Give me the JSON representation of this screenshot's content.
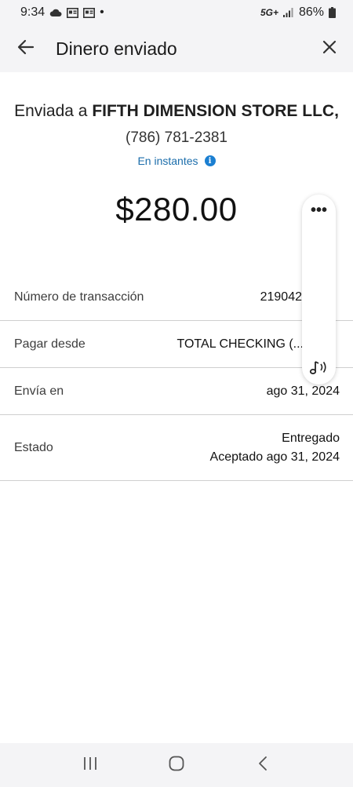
{
  "status_bar": {
    "time": "9:34",
    "dot": "•",
    "network": "5G+",
    "battery": "86%"
  },
  "header": {
    "title": "Dinero enviado",
    "back_icon": "arrow-left-icon",
    "close_icon": "close-icon"
  },
  "recipient": {
    "prefix": "Enviada a ",
    "name": "FIFTH DIMENSION STORE LLC,",
    "phone": "(786) 781-2381",
    "speed": "En instantes"
  },
  "amount": "$280.00",
  "details": {
    "transaction": {
      "label": "Número de transacción",
      "value": "219042"
    },
    "pay_from": {
      "label": "Pagar desde",
      "value": "TOTAL CHECKING (..."
    },
    "sends_on": {
      "label": "Envía en",
      "value": "ago 31, 2024"
    },
    "status": {
      "label": "Estado",
      "value": "Entregado",
      "sub": "Aceptado ago 31, 2024"
    }
  },
  "overlay": {
    "more_icon": "more-horizontal-icon",
    "more_label": "•••",
    "audio_icon": "read-aloud-icon"
  },
  "nav": {
    "recents_icon": "recents-icon",
    "home_icon": "home-icon",
    "back_icon": "nav-back-icon"
  }
}
